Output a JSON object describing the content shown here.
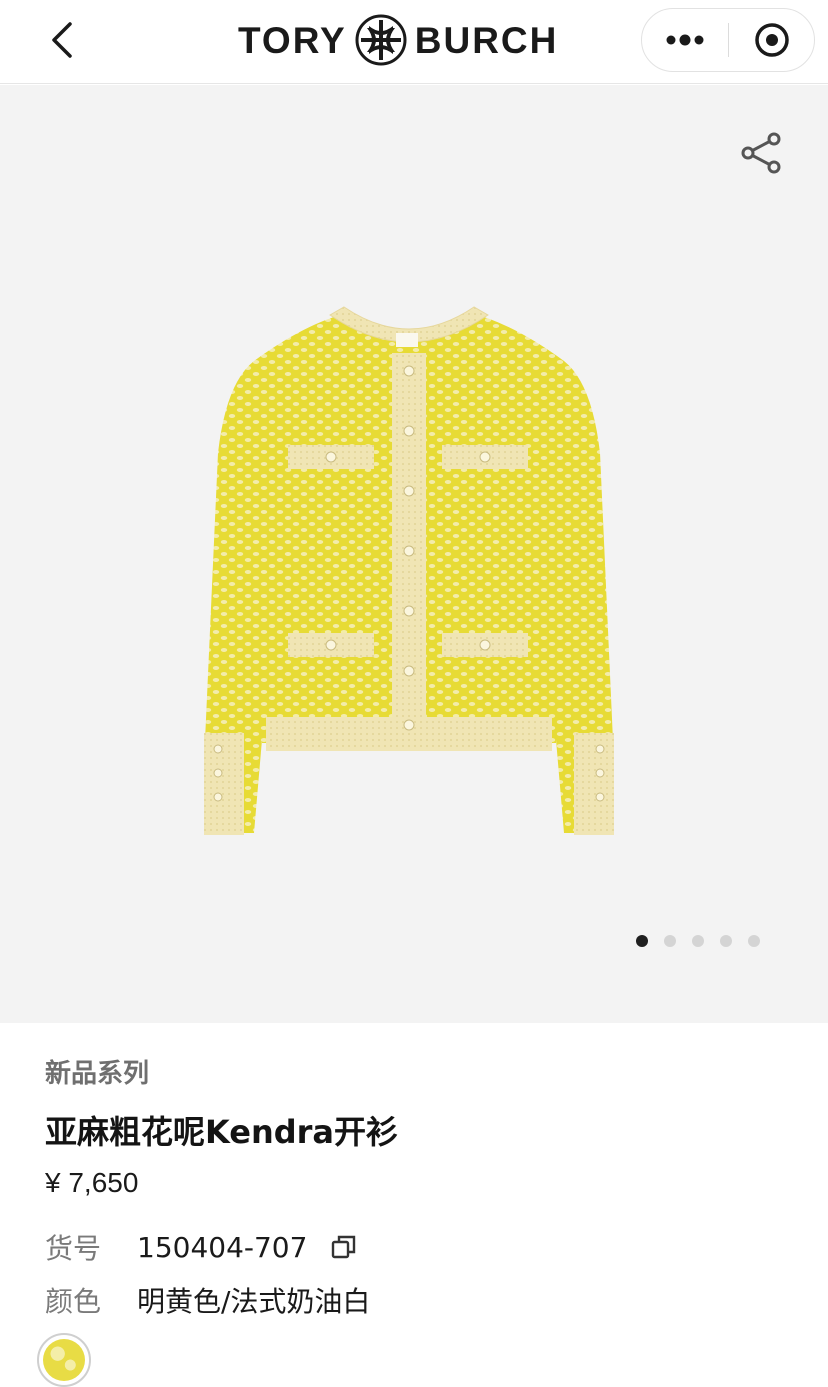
{
  "header": {
    "brand_left": "TORY",
    "brand_right": "BURCH",
    "back_icon": "chevron-left-icon",
    "more_icon": "more-dots-icon",
    "close_icon": "target-circle-icon"
  },
  "gallery": {
    "share_icon": "share-icon",
    "image_count": 5,
    "active_index": 0,
    "colors": {
      "background": "#f3f3f3",
      "knit_yellow": "#eadf3a",
      "trim_cream": "#f1e6b8",
      "dot_active": "#1f1f1f",
      "dot_inactive": "#d4d4d4"
    }
  },
  "product": {
    "collection": "新品系列",
    "title": "亚麻粗花呢Kendra开衫",
    "price": "¥ 7,650",
    "sku_label": "货号",
    "sku_value": "150404-707",
    "color_label": "颜色",
    "color_value": "明黄色/法式奶油白",
    "copy_icon": "copy-icon",
    "swatch_color": "#e8dc45"
  }
}
